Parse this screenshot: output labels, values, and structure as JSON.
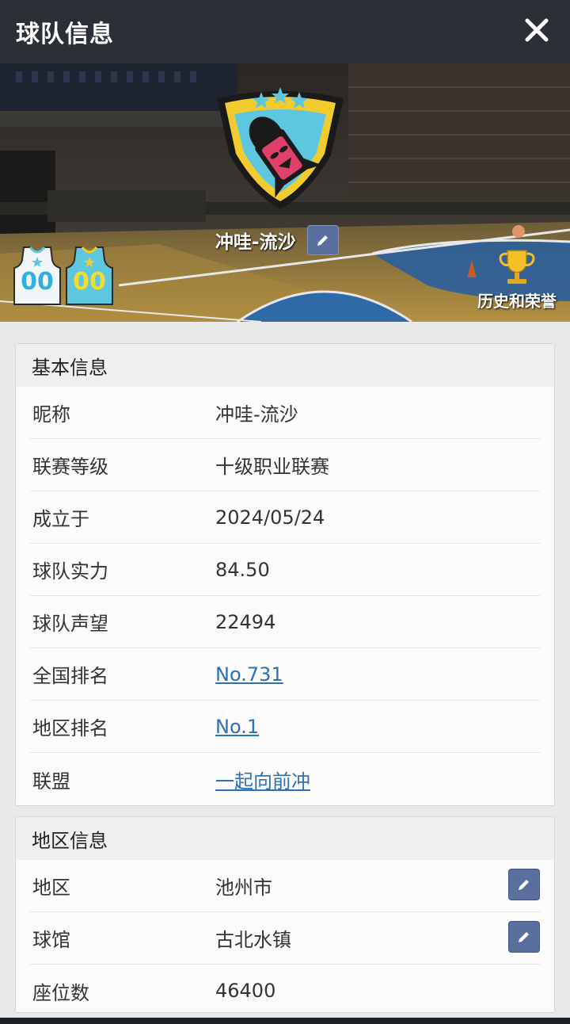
{
  "header": {
    "title": "球队信息",
    "close_icon": "close-icon"
  },
  "banner": {
    "team_name": "冲哇-流沙",
    "emblem_icon": "rocket-shield-emblem",
    "home_jersey_number": "00",
    "away_jersey_number": "00",
    "honor_label": "历史和荣誉",
    "honor_icon": "trophy-icon"
  },
  "basic": {
    "title": "基本信息",
    "rows": [
      {
        "key": "昵称",
        "value": "冲哇-流沙"
      },
      {
        "key": "联赛等级",
        "value": "十级职业联赛"
      },
      {
        "key": "成立于",
        "value": "2024/05/24"
      },
      {
        "key": "球队实力",
        "value": "84.50"
      },
      {
        "key": "球队声望",
        "value": "22494"
      },
      {
        "key": "全国排名",
        "value": "No.731"
      },
      {
        "key": "地区排名",
        "value": "No.1"
      },
      {
        "key": "联盟",
        "value": "一起向前冲"
      }
    ]
  },
  "region": {
    "title": "地区信息",
    "rows": [
      {
        "key": "地区",
        "value": "池州市"
      },
      {
        "key": "球馆",
        "value": "古北水镇"
      },
      {
        "key": "座位数",
        "value": "46400"
      }
    ]
  },
  "colors": {
    "accent_link": "#2f6fb3",
    "edit_button": "#5b6f9e",
    "topbar": "#2b2f36"
  }
}
